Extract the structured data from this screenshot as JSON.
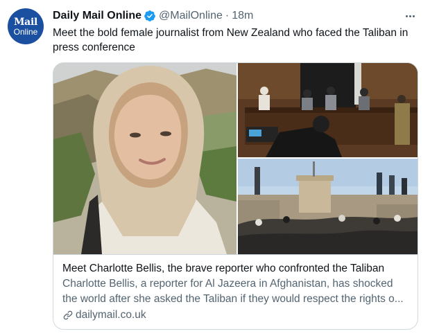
{
  "author": {
    "avatar_line1": "Mail",
    "avatar_line2": "Online",
    "name": "Daily Mail Online",
    "handle": "@MailOnline",
    "separator": "·",
    "time": "18m"
  },
  "tweet": {
    "text": "Meet the bold female journalist from New Zealand who faced the Taliban in press conference"
  },
  "card": {
    "title": "Meet Charlotte Bellis, the brave reporter who confronted the Taliban",
    "description": "Charlotte Bellis, a reporter for Al Jazeera in Afghanistan, has shocked the world after she asked the Taliban if they would respect the rights o...",
    "domain": "dailymail.co.uk"
  },
  "colors": {
    "avatar_bg": "#1b4fa0",
    "verified": "#1d9bf0",
    "secondary_text": "#536471",
    "border": "#cfd9de"
  },
  "icons": [
    "verified-badge-icon",
    "more-options-icon",
    "link-icon"
  ]
}
